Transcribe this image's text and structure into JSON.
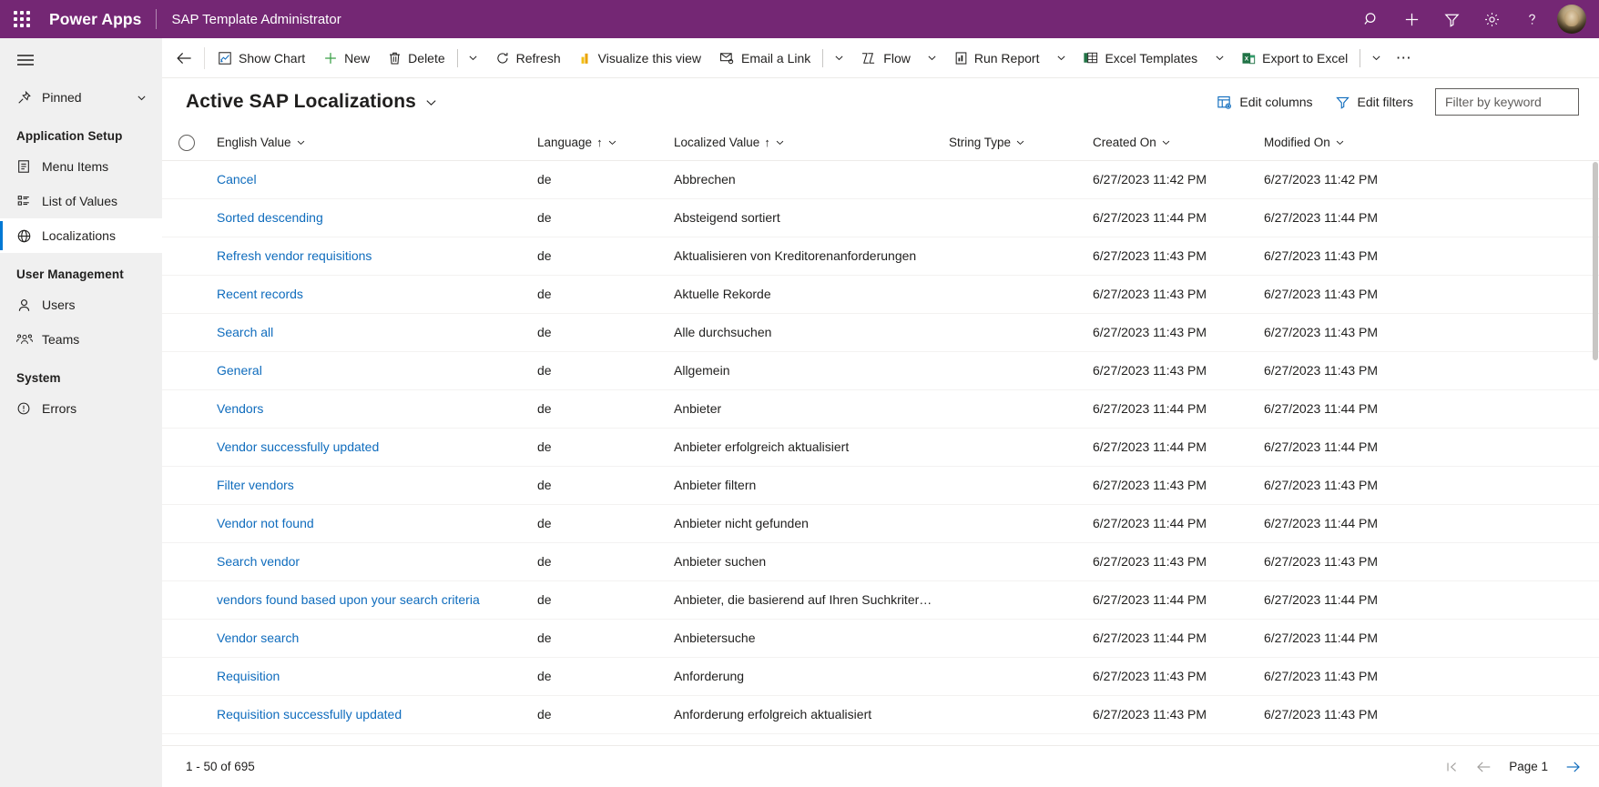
{
  "topbar": {
    "waffle_label": "waffle-menu",
    "brand": "Power Apps",
    "app_name": "SAP Template Administrator",
    "background": "#742774",
    "icons": [
      {
        "name": "search-icon",
        "label": "Search"
      },
      {
        "name": "plus-icon",
        "label": "New"
      },
      {
        "name": "filter-icon",
        "label": "Filter"
      },
      {
        "name": "gear-icon",
        "label": "Settings"
      },
      {
        "name": "help-icon",
        "label": "Help"
      }
    ],
    "avatar_name": "user-avatar"
  },
  "sidebar": {
    "hamburger": "site-map-toggle",
    "pinned": {
      "label": "Pinned",
      "icon": "pin-icon",
      "chevron": "chevron-down-icon"
    },
    "groups": [
      {
        "title": "Application Setup",
        "items": [
          {
            "label": "Menu Items",
            "icon": "document-icon",
            "selected": false
          },
          {
            "label": "List of Values",
            "icon": "list-icon",
            "selected": false
          },
          {
            "label": "Localizations",
            "icon": "globe-icon",
            "selected": true
          }
        ]
      },
      {
        "title": "User Management",
        "items": [
          {
            "label": "Users",
            "icon": "person-icon",
            "selected": false
          },
          {
            "label": "Teams",
            "icon": "people-icon",
            "selected": false
          }
        ]
      },
      {
        "title": "System",
        "items": [
          {
            "label": "Errors",
            "icon": "error-icon",
            "selected": false
          }
        ]
      }
    ],
    "selected_accent": "#0078d4"
  },
  "commandbar": {
    "back_icon": "back-arrow-icon",
    "buttons": [
      {
        "label": "Show Chart",
        "icon": "chart-icon",
        "caret": false
      },
      {
        "label": "New",
        "icon": "plus-icon",
        "caret": false
      },
      {
        "label": "Delete",
        "icon": "trash-icon",
        "caret": true,
        "separator": true
      },
      {
        "label": "Refresh",
        "icon": "refresh-icon",
        "caret": false
      },
      {
        "label": "Visualize this view",
        "icon": "visualize-icon",
        "caret": false
      },
      {
        "label": "Email a Link",
        "icon": "email-icon",
        "caret": true,
        "separator": true
      },
      {
        "label": "Flow",
        "icon": "flow-icon",
        "caret": true
      },
      {
        "label": "Run Report",
        "icon": "report-icon",
        "caret": true
      },
      {
        "label": "Excel Templates",
        "icon": "excel-template-icon",
        "caret": true
      },
      {
        "label": "Export to Excel",
        "icon": "excel-icon",
        "caret": true,
        "separator": true
      }
    ],
    "overflow": "⋯",
    "overflow_name": "more-commands"
  },
  "view": {
    "title": "Active SAP Localizations",
    "title_caret": "chevron-down-icon",
    "edit_columns": {
      "label": "Edit columns",
      "icon": "edit-columns-icon"
    },
    "edit_filters": {
      "label": "Edit filters",
      "icon": "filter-icon"
    },
    "search": {
      "placeholder": "Filter by keyword",
      "value": ""
    },
    "accent": "#0f6cbd"
  },
  "grid": {
    "select_all_name": "select-all-checkbox",
    "columns": [
      {
        "label": "English Value",
        "sort": "",
        "caret": "chevron-down-icon"
      },
      {
        "label": "Language",
        "sort": "↑",
        "caret": "chevron-down-icon"
      },
      {
        "label": "Localized Value",
        "sort": "↑",
        "caret": "chevron-down-icon"
      },
      {
        "label": "String Type",
        "sort": "",
        "caret": "chevron-down-icon"
      },
      {
        "label": "Created On",
        "sort": "",
        "caret": "chevron-down-icon"
      },
      {
        "label": "Modified On",
        "sort": "",
        "caret": "chevron-down-icon"
      }
    ],
    "rows": [
      {
        "english": "Cancel",
        "language": "de",
        "localized": "Abbrechen",
        "string_type": "",
        "created": "6/27/2023 11:42 PM",
        "modified": "6/27/2023 11:42 PM"
      },
      {
        "english": "Sorted descending",
        "language": "de",
        "localized": "Absteigend sortiert",
        "string_type": "",
        "created": "6/27/2023 11:44 PM",
        "modified": "6/27/2023 11:44 PM"
      },
      {
        "english": "Refresh vendor requisitions",
        "language": "de",
        "localized": "Aktualisieren von Kreditorenanforderungen",
        "string_type": "",
        "created": "6/27/2023 11:43 PM",
        "modified": "6/27/2023 11:43 PM"
      },
      {
        "english": "Recent records",
        "language": "de",
        "localized": "Aktuelle Rekorde",
        "string_type": "",
        "created": "6/27/2023 11:43 PM",
        "modified": "6/27/2023 11:43 PM"
      },
      {
        "english": "Search all",
        "language": "de",
        "localized": "Alle durchsuchen",
        "string_type": "",
        "created": "6/27/2023 11:43 PM",
        "modified": "6/27/2023 11:43 PM"
      },
      {
        "english": "General",
        "language": "de",
        "localized": "Allgemein",
        "string_type": "",
        "created": "6/27/2023 11:43 PM",
        "modified": "6/27/2023 11:43 PM"
      },
      {
        "english": "Vendors",
        "language": "de",
        "localized": "Anbieter",
        "string_type": "",
        "created": "6/27/2023 11:44 PM",
        "modified": "6/27/2023 11:44 PM"
      },
      {
        "english": "Vendor successfully updated",
        "language": "de",
        "localized": "Anbieter erfolgreich aktualisiert",
        "string_type": "",
        "created": "6/27/2023 11:44 PM",
        "modified": "6/27/2023 11:44 PM"
      },
      {
        "english": "Filter vendors",
        "language": "de",
        "localized": "Anbieter filtern",
        "string_type": "",
        "created": "6/27/2023 11:43 PM",
        "modified": "6/27/2023 11:43 PM"
      },
      {
        "english": "Vendor not found",
        "language": "de",
        "localized": "Anbieter nicht gefunden",
        "string_type": "",
        "created": "6/27/2023 11:44 PM",
        "modified": "6/27/2023 11:44 PM"
      },
      {
        "english": "Search vendor",
        "language": "de",
        "localized": "Anbieter suchen",
        "string_type": "",
        "created": "6/27/2023 11:43 PM",
        "modified": "6/27/2023 11:43 PM"
      },
      {
        "english": "vendors found based upon your search criteria",
        "language": "de",
        "localized": "Anbieter, die basierend auf Ihren Suchkriterien g...",
        "string_type": "",
        "created": "6/27/2023 11:44 PM",
        "modified": "6/27/2023 11:44 PM"
      },
      {
        "english": "Vendor search",
        "language": "de",
        "localized": "Anbietersuche",
        "string_type": "",
        "created": "6/27/2023 11:44 PM",
        "modified": "6/27/2023 11:44 PM"
      },
      {
        "english": "Requisition",
        "language": "de",
        "localized": "Anforderung",
        "string_type": "",
        "created": "6/27/2023 11:43 PM",
        "modified": "6/27/2023 11:43 PM"
      },
      {
        "english": "Requisition successfully updated",
        "language": "de",
        "localized": "Anforderung erfolgreich aktualisiert",
        "string_type": "",
        "created": "6/27/2023 11:43 PM",
        "modified": "6/27/2023 11:43 PM"
      }
    ]
  },
  "footer": {
    "record_count": "1 - 50 of 695",
    "first_page_icon": "first-page-icon",
    "prev_page_icon": "previous-page-icon",
    "page_label": "Page 1",
    "next_page_icon": "next-page-icon",
    "next_enabled_color": "#0f6cbd"
  }
}
